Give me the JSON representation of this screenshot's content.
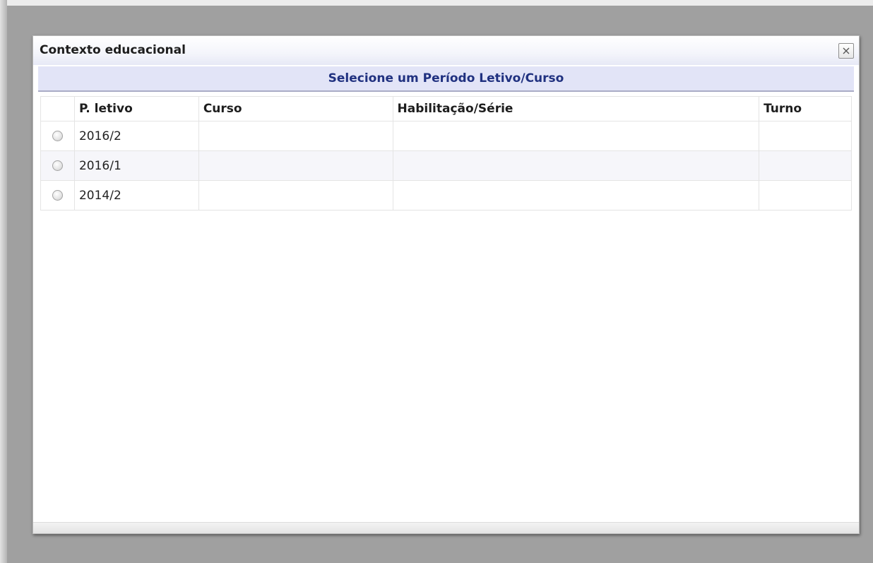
{
  "dialog": {
    "title": "Contexto educacional",
    "close_icon": "close-icon",
    "subtitle": "Selecione um Período Letivo/Curso"
  },
  "table": {
    "headers": [
      "",
      "P. letivo",
      "Curso",
      "Habilitação/Série",
      "Turno"
    ],
    "rows": [
      {
        "periodo": "2016/2",
        "curso": "",
        "habilitacao": "",
        "turno": ""
      },
      {
        "periodo": "2016/1",
        "curso": "",
        "habilitacao": "",
        "turno": ""
      },
      {
        "periodo": "2014/2",
        "curso": "",
        "habilitacao": "",
        "turno": ""
      }
    ]
  },
  "colors": {
    "overlay": "#a0a0a0",
    "subheader_bg": "#e2e4f7",
    "subheader_text": "#203180"
  }
}
